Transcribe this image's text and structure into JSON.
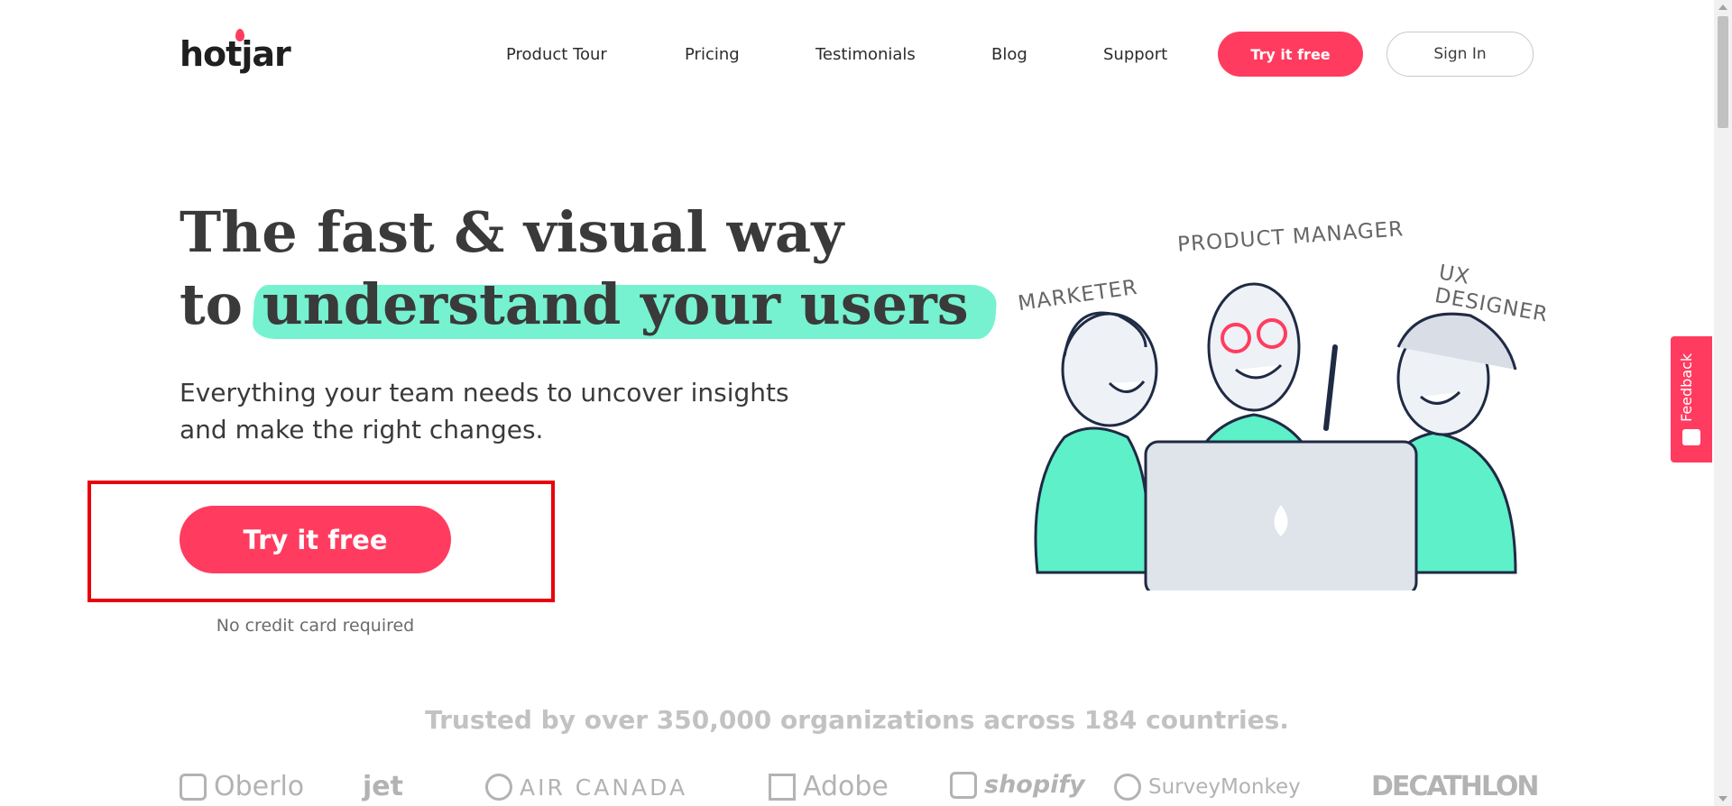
{
  "header": {
    "logo_text": "hotjar",
    "nav": [
      {
        "label": "Product Tour"
      },
      {
        "label": "Pricing"
      },
      {
        "label": "Testimonials"
      },
      {
        "label": "Blog"
      },
      {
        "label": "Support"
      }
    ],
    "try_label": "Try it free",
    "signin_label": "Sign In"
  },
  "hero": {
    "title_line1": "The fast & visual way",
    "title_prefix": "to",
    "title_highlight": "understand your users",
    "subtitle": "Everything your team needs to uncover insights and make the right changes.",
    "cta_label": "Try it free",
    "cta_note": "No credit card required"
  },
  "illustration": {
    "labels": [
      "MARKETER",
      "PRODUCT MANAGER",
      "UX DESIGNER"
    ]
  },
  "trusted": {
    "heading": "Trusted by over 350,000 organizations across 184 countries.",
    "brands": [
      "Oberlo",
      "jet",
      "AIR CANADA",
      "Adobe",
      "shopify",
      "SurveyMonkey",
      "DECATHLON"
    ]
  },
  "feedback": {
    "label": "Feedback"
  },
  "colors": {
    "accent": "#ff3c5f",
    "highlight": "#5ef0c8",
    "annotation_frame": "#e8000b"
  }
}
